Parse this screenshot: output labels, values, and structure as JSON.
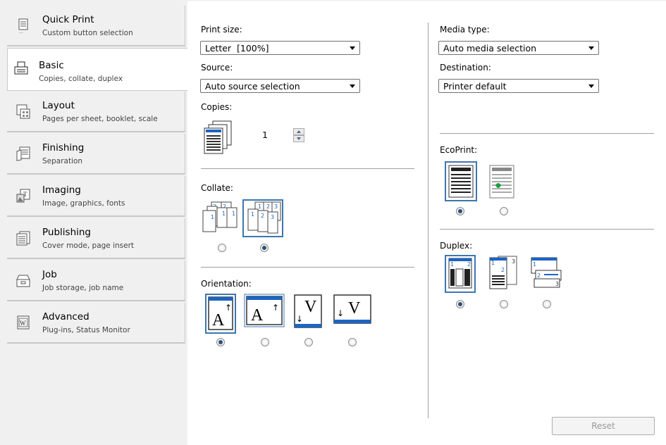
{
  "sidebar": {
    "tabs": [
      {
        "title": "Quick Print",
        "subtitle": "Custom button selection",
        "icon": "quick-print-icon"
      },
      {
        "title": "Basic",
        "subtitle": "Copies, collate, duplex",
        "icon": "basic-icon"
      },
      {
        "title": "Layout",
        "subtitle": "Pages per sheet, booklet, scale",
        "icon": "layout-icon"
      },
      {
        "title": "Finishing",
        "subtitle": "Separation",
        "icon": "finishing-icon"
      },
      {
        "title": "Imaging",
        "subtitle": "Image, graphics, fonts",
        "icon": "imaging-icon"
      },
      {
        "title": "Publishing",
        "subtitle": "Cover mode, page insert",
        "icon": "publishing-icon"
      },
      {
        "title": "Job",
        "subtitle": "Job storage, job name",
        "icon": "job-icon"
      },
      {
        "title": "Advanced",
        "subtitle": "Plug-ins, Status Monitor",
        "icon": "advanced-icon"
      }
    ],
    "active_tab": "Basic"
  },
  "basic": {
    "print_size": {
      "label": "Print size:",
      "value": "Letter  [100%]"
    },
    "source": {
      "label": "Source:",
      "value": "Auto source selection"
    },
    "copies": {
      "label": "Copies:",
      "value": "1"
    },
    "collate": {
      "label": "Collate:",
      "options": [
        "uncollated",
        "collated"
      ],
      "selected": "collated"
    },
    "orientation": {
      "label": "Orientation:",
      "options": [
        "portrait",
        "landscape",
        "portrait-rotated",
        "landscape-rotated"
      ],
      "selected": "portrait"
    },
    "media_type": {
      "label": "Media type:",
      "value": "Auto media selection"
    },
    "destination": {
      "label": "Destination:",
      "value": "Printer default"
    },
    "ecoprint": {
      "label": "EcoPrint:",
      "options": [
        "off",
        "on"
      ],
      "selected": "off"
    },
    "duplex": {
      "label": "Duplex:",
      "options": [
        "none",
        "flip-long-edge",
        "flip-short-edge"
      ],
      "selected": "none"
    },
    "reset_label": "Reset"
  },
  "colors": {
    "accent": "#1b65c4",
    "icon_border": "#4a7fb5",
    "frame": "#3c76b0"
  }
}
